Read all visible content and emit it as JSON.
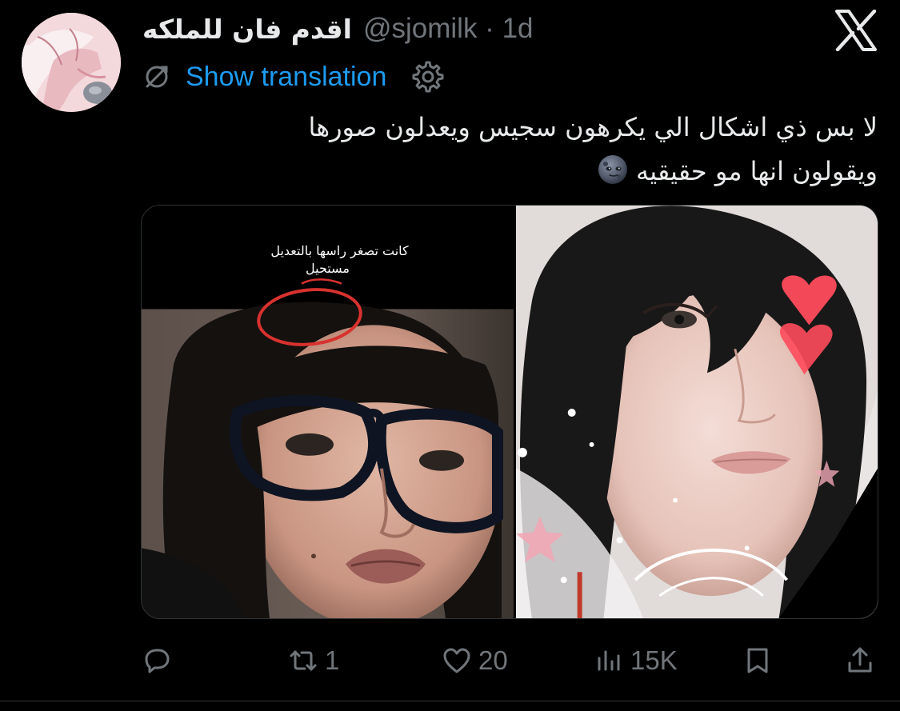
{
  "author": {
    "display_name": "اقدم فان للملكه",
    "handle_time": "@sjomilk · 1d"
  },
  "translation": {
    "label": "Show translation"
  },
  "tweet": {
    "line1": "لا بس ذي اشكال الي يكرهون سجيس ويعدلون صورها",
    "line2": "ويقولون انها مو حقيقيه"
  },
  "media": {
    "left_caption_line1": "كانت تصغر راسها بالتعديل",
    "left_caption_line2": "مستحيل"
  },
  "actions": {
    "reply_count": "",
    "retweet_count": "1",
    "like_count": "20",
    "views_count": "15K"
  },
  "colors": {
    "background": "#000000",
    "text_primary": "#e7e9ea",
    "text_secondary": "#71767b",
    "link": "#1d9bf0"
  },
  "icons": [
    "x-logo-icon",
    "translate-icon",
    "settings-icon",
    "new-moon-face-emoji",
    "reply-icon",
    "retweet-icon",
    "like-icon",
    "views-icon",
    "bookmark-icon",
    "share-icon"
  ]
}
